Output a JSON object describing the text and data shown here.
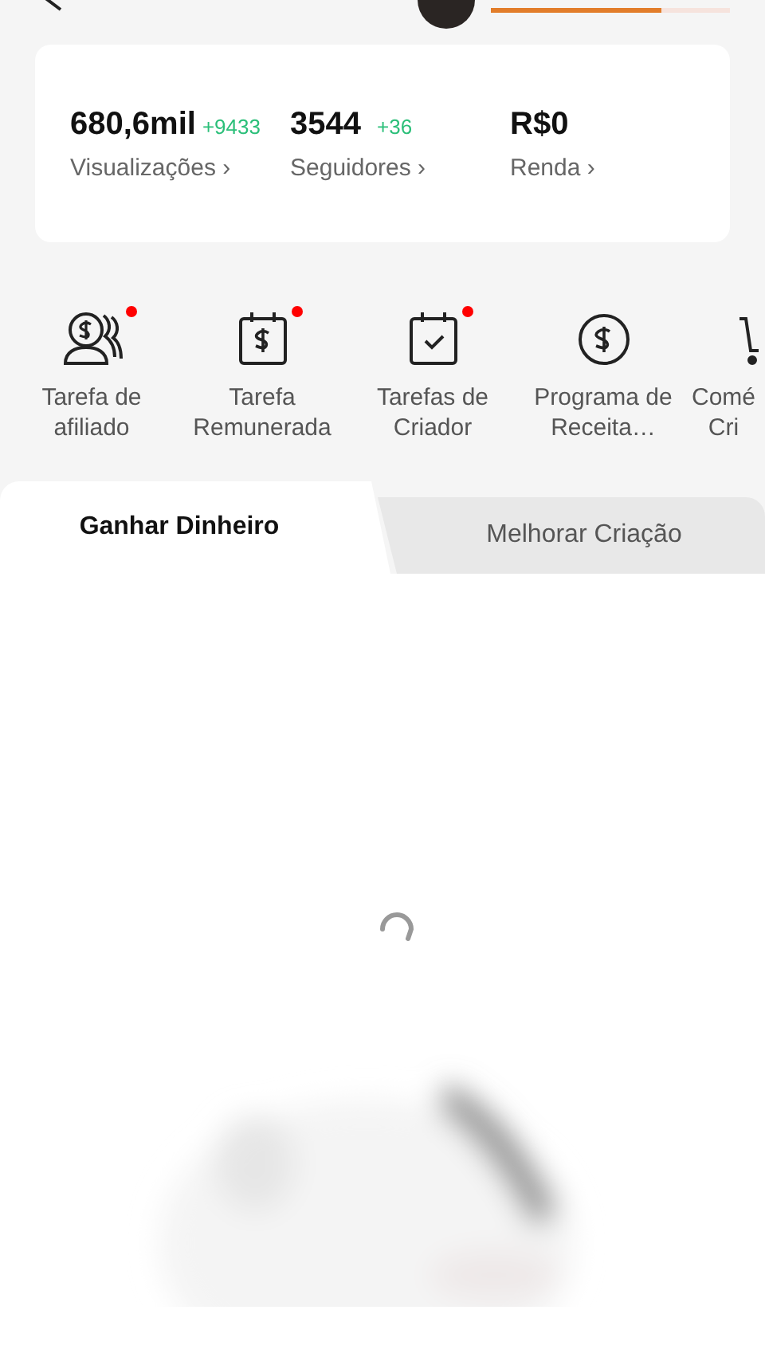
{
  "header": {
    "progress": {
      "level": 0.71
    }
  },
  "stats": [
    {
      "value": "680,6mil",
      "delta": "+9433",
      "label": "Visualizações ›"
    },
    {
      "value": "3544",
      "delta": "+36",
      "label": "Seguidores ›"
    },
    {
      "value": "R$0",
      "label": "Renda ›"
    }
  ],
  "tasks": [
    {
      "kind": "affiliate",
      "label": "Tarefa de afiliado",
      "badge": true
    },
    {
      "kind": "paid",
      "label": "Tarefa Remunerada",
      "badge": true
    },
    {
      "kind": "creator",
      "label": "Tarefas de Criador",
      "badge": true
    },
    {
      "kind": "revenue",
      "label": "Programa de Receita…",
      "badge": false
    },
    {
      "kind": "commerce",
      "label": "Comé Cri",
      "badge": false
    }
  ],
  "tabs": [
    {
      "label": "Ganhar Dinheiro",
      "selected": true
    },
    {
      "label": "Melhorar Criação",
      "selected": false
    }
  ],
  "content": {
    "loading": true,
    "kind": "picture"
  }
}
